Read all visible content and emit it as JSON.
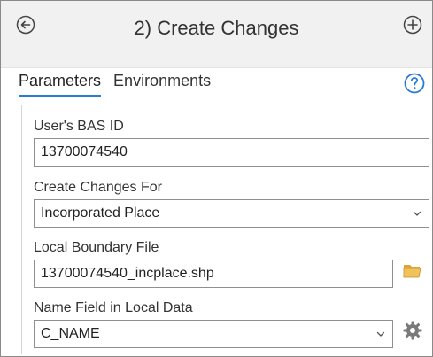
{
  "header": {
    "title": "2) Create Changes"
  },
  "tabs": [
    {
      "label": "Parameters",
      "active": true
    },
    {
      "label": "Environments",
      "active": false
    }
  ],
  "params": {
    "bas_id": {
      "label": "User's BAS ID",
      "value": "13700074540"
    },
    "create_changes_for": {
      "label": "Create Changes For",
      "value": "Incorporated Place"
    },
    "local_boundary_file": {
      "label": "Local Boundary File",
      "value": "13700074540_incplace.shp"
    },
    "name_field": {
      "label": "Name Field in Local Data",
      "value": "C_NAME"
    }
  },
  "icons": {
    "back": "back-arrow-circle-icon",
    "add": "plus-circle-icon",
    "help": "help-circle-icon",
    "folder": "folder-icon",
    "gear": "gear-icon",
    "dropdown": "chevron-down-icon"
  },
  "colors": {
    "accent": "#2a7bd3",
    "folder": "#e8b64a",
    "border": "#8f8f8f",
    "header_bg": "#f1f1f1"
  }
}
